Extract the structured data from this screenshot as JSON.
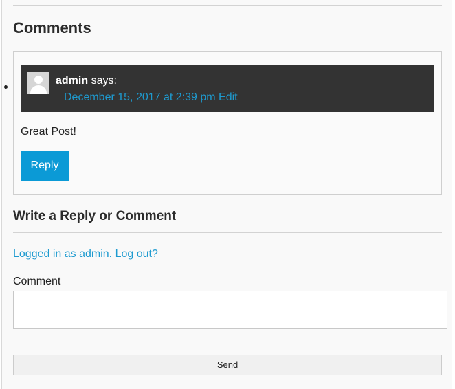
{
  "comments_section": {
    "title": "Comments"
  },
  "comment": {
    "author": "admin",
    "says": "says:",
    "date": "December 15, 2017 at 2:39 pm",
    "edit_label": "Edit",
    "text": "Great Post!",
    "reply_label": "Reply",
    "avatar_icon": "default-avatar-icon"
  },
  "reply_form": {
    "title": "Write a Reply or Comment",
    "logged_in_text": "Logged in as admin.",
    "logout_text": "Log out?",
    "comment_label": "Comment",
    "comment_value": "",
    "send_label": "Send"
  },
  "colors": {
    "link": "#1e9bd0",
    "reply_button": "#0b9ad6",
    "comment_header_bg": "#333333"
  }
}
